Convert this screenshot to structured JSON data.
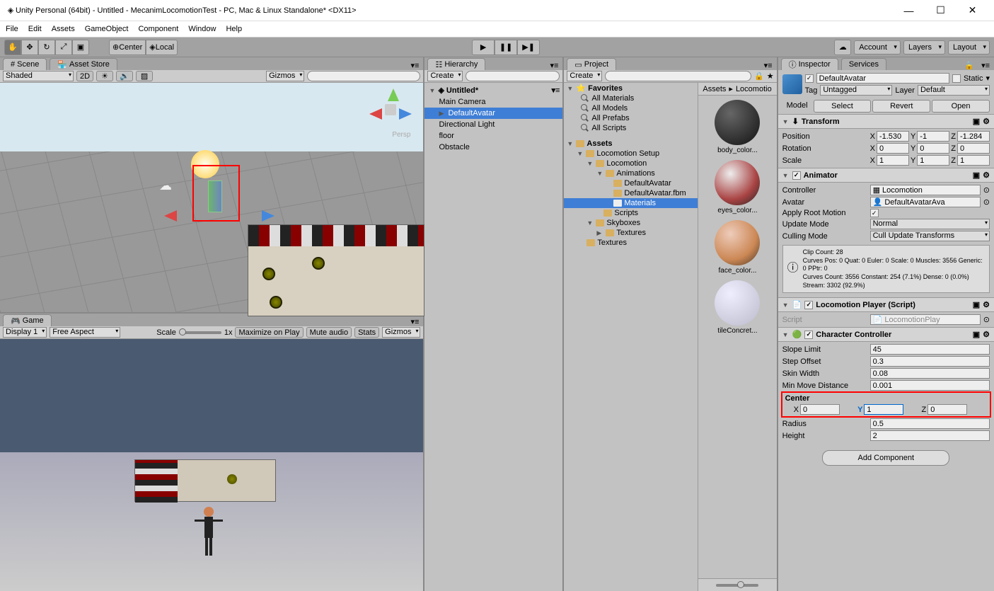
{
  "window": {
    "title": "Unity Personal (64bit) - Untitled - MecanimLocomotionTest - PC, Mac & Linux Standalone* <DX11>"
  },
  "menu": [
    "File",
    "Edit",
    "Assets",
    "GameObject",
    "Component",
    "Window",
    "Help"
  ],
  "toolbar": {
    "center": "Center",
    "local": "Local",
    "account": "Account",
    "layers": "Layers",
    "layout": "Layout"
  },
  "scene": {
    "tab": "Scene",
    "asset_tab": "Asset Store",
    "shaded": "Shaded",
    "mode2d": "2D",
    "gizmos": "Gizmos",
    "persp": "Persp"
  },
  "game": {
    "tab": "Game",
    "display": "Display 1",
    "aspect": "Free Aspect",
    "scale": "Scale",
    "scale_val": "1x",
    "max": "Maximize on Play",
    "mute": "Mute audio",
    "stats": "Stats",
    "gizmos": "Gizmos"
  },
  "hierarchy": {
    "tab": "Hierarchy",
    "create": "Create",
    "scene_name": "Untitled*",
    "items": [
      "Main Camera",
      "DefaultAvatar",
      "Directional Light",
      "floor",
      "Obstacle"
    ]
  },
  "project": {
    "tab": "Project",
    "create": "Create",
    "favorites": "Favorites",
    "fav_items": [
      "All Materials",
      "All Models",
      "All Prefabs",
      "All Scripts"
    ],
    "assets": "Assets",
    "tree": {
      "loco_setup": "Locomotion Setup",
      "locomotion": "Locomotion",
      "animations": "Animations",
      "default_avatar": "DefaultAvatar",
      "default_avatar_fbm": "DefaultAvatar.fbm",
      "materials": "Materials",
      "scripts": "Scripts",
      "skyboxes": "Skyboxes",
      "textures": "Textures",
      "textures2": "Textures"
    },
    "breadcrumb": [
      "Assets",
      "Locomotio"
    ],
    "thumbs": [
      "body_color...",
      "eyes_color...",
      "face_color...",
      "tileConcret..."
    ]
  },
  "inspector": {
    "tab": "Inspector",
    "services": "Services",
    "name": "DefaultAvatar",
    "static": "Static",
    "tag": "Tag",
    "tag_val": "Untagged",
    "layer": "Layer",
    "layer_val": "Default",
    "model": "Model",
    "select": "Select",
    "revert": "Revert",
    "open": "Open",
    "transform": {
      "title": "Transform",
      "position": "Position",
      "rotation": "Rotation",
      "scale": "Scale",
      "pos": {
        "x": "-1.530",
        "y": "-1",
        "z": "-1.284"
      },
      "rot": {
        "x": "0",
        "y": "0",
        "z": "0"
      },
      "scl": {
        "x": "1",
        "y": "1",
        "z": "1"
      }
    },
    "animator": {
      "title": "Animator",
      "controller": "Controller",
      "controller_val": "Locomotion",
      "avatar": "Avatar",
      "avatar_val": "DefaultAvatarAva",
      "root_motion": "Apply Root Motion",
      "update_mode": "Update Mode",
      "update_mode_val": "Normal",
      "culling_mode": "Culling Mode",
      "culling_mode_val": "Cull Update Transforms",
      "info": "Clip Count: 28\nCurves Pos: 0 Quat: 0 Euler: 0 Scale: 0 Muscles: 3556 Generic: 0 PPtr: 0\nCurves Count: 3556 Constant: 254 (7.1%) Dense: 0 (0.0%) Stream: 3302 (92.9%)"
    },
    "loco_script": {
      "title": "Locomotion Player (Script)",
      "script": "Script",
      "script_val": "LocomotionPlay"
    },
    "char_ctrl": {
      "title": "Character Controller",
      "slope": "Slope Limit",
      "slope_val": "45",
      "step": "Step Offset",
      "step_val": "0.3",
      "skin": "Skin Width",
      "skin_val": "0.08",
      "min_move": "Min Move Distance",
      "min_move_val": "0.001",
      "center": "Center",
      "center_vals": {
        "x": "0",
        "y": "1",
        "z": "0"
      },
      "radius": "Radius",
      "radius_val": "0.5",
      "height": "Height",
      "height_val": "2"
    },
    "add_component": "Add Component"
  }
}
